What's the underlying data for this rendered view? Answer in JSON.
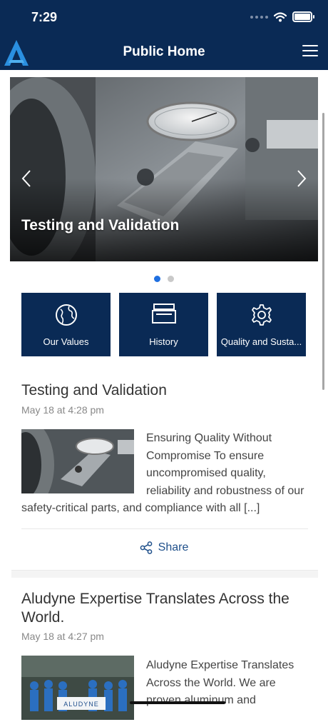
{
  "status": {
    "time": "7:29"
  },
  "header": {
    "title": "Public Home"
  },
  "carousel": {
    "slides": [
      {
        "caption": "Testing and Validation"
      }
    ],
    "active_index": 0,
    "dot_count": 2
  },
  "tiles": [
    {
      "label": "Our Values",
      "icon": "globe-icon"
    },
    {
      "label": "History",
      "icon": "archive-icon"
    },
    {
      "label": "Quality and Susta...",
      "icon": "gear-icon"
    }
  ],
  "posts": [
    {
      "title": "Testing and Validation",
      "date": "May 18 at 4:28 pm",
      "excerpt": "Ensuring Quality Without Compromise To ensure uncompromised quality, reliability and robustness of our safety-critical parts, and compliance with all [...]",
      "share_label": "Share"
    },
    {
      "title": "Aludyne Expertise Translates Across the World.",
      "date": "May 18 at 4:27 pm",
      "excerpt": "Aludyne Expertise Translates Across the World. We are proven aluminum and",
      "banner_text": "ALUDYNE"
    }
  ],
  "colors": {
    "brand_navy": "#0a2a55",
    "accent_blue": "#1f6fe0",
    "link_blue": "#1e4f8a"
  }
}
